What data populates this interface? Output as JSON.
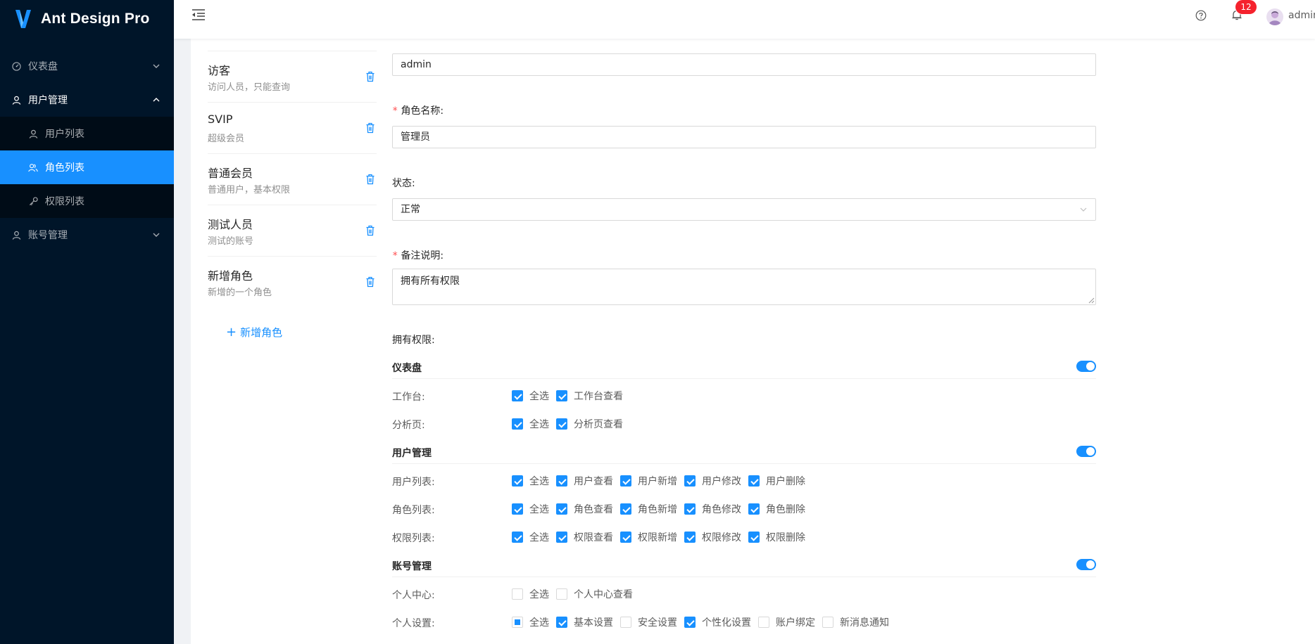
{
  "app": {
    "title": "Ant Design Pro"
  },
  "sidebar": {
    "items": [
      {
        "label": "仪表盘",
        "icon": "dashboard-icon",
        "open": false
      },
      {
        "label": "用户管理",
        "icon": "user-icon",
        "open": true,
        "children": [
          {
            "label": "用户列表",
            "icon": "user-icon"
          },
          {
            "label": "角色列表",
            "icon": "team-icon",
            "active": true
          },
          {
            "label": "权限列表",
            "icon": "key-icon"
          }
        ]
      },
      {
        "label": "账号管理",
        "icon": "user-icon",
        "open": false
      }
    ]
  },
  "header": {
    "notification_count": "12",
    "user_name": "admin"
  },
  "roles": {
    "items": [
      {
        "name": "访客",
        "desc": "访问人员，只能查询"
      },
      {
        "name": "SVIP",
        "desc": "超级会员"
      },
      {
        "name": "普通会员",
        "desc": "普通用户，基本权限"
      },
      {
        "name": "测试人员",
        "desc": "测试的账号"
      },
      {
        "name": "新增角色",
        "desc": "新增的一个角色"
      }
    ],
    "add_label": "新增角色"
  },
  "form": {
    "role_key_value": "admin",
    "role_name_label": "角色名称:",
    "role_name_value": "管理员",
    "status_label": "状态:",
    "status_value": "正常",
    "remark_label": "备注说明:",
    "remark_value": "拥有所有权限",
    "permissions_label": "拥有权限:"
  },
  "permissions": {
    "groups": [
      {
        "title": "仪表盘",
        "enabled": true,
        "rows": [
          {
            "label": "工作台:",
            "options": [
              {
                "label": "全选",
                "state": "checked"
              },
              {
                "label": "工作台查看",
                "state": "checked"
              }
            ]
          },
          {
            "label": "分析页:",
            "options": [
              {
                "label": "全选",
                "state": "checked"
              },
              {
                "label": "分析页查看",
                "state": "checked"
              }
            ]
          }
        ]
      },
      {
        "title": "用户管理",
        "enabled": true,
        "rows": [
          {
            "label": "用户列表:",
            "options": [
              {
                "label": "全选",
                "state": "checked"
              },
              {
                "label": "用户查看",
                "state": "checked"
              },
              {
                "label": "用户新增",
                "state": "checked"
              },
              {
                "label": "用户修改",
                "state": "checked"
              },
              {
                "label": "用户删除",
                "state": "checked"
              }
            ]
          },
          {
            "label": "角色列表:",
            "options": [
              {
                "label": "全选",
                "state": "checked"
              },
              {
                "label": "角色查看",
                "state": "checked"
              },
              {
                "label": "角色新增",
                "state": "checked"
              },
              {
                "label": "角色修改",
                "state": "checked"
              },
              {
                "label": "角色删除",
                "state": "checked"
              }
            ]
          },
          {
            "label": "权限列表:",
            "options": [
              {
                "label": "全选",
                "state": "checked"
              },
              {
                "label": "权限查看",
                "state": "checked"
              },
              {
                "label": "权限新增",
                "state": "checked"
              },
              {
                "label": "权限修改",
                "state": "checked"
              },
              {
                "label": "权限删除",
                "state": "checked"
              }
            ]
          }
        ]
      },
      {
        "title": "账号管理",
        "enabled": true,
        "rows": [
          {
            "label": "个人中心:",
            "options": [
              {
                "label": "全选",
                "state": "unchecked"
              },
              {
                "label": "个人中心查看",
                "state": "unchecked"
              }
            ]
          },
          {
            "label": "个人设置:",
            "options": [
              {
                "label": "全选",
                "state": "indeterminate"
              },
              {
                "label": "基本设置",
                "state": "checked"
              },
              {
                "label": "安全设置",
                "state": "unchecked"
              },
              {
                "label": "个性化设置",
                "state": "checked"
              },
              {
                "label": "账户绑定",
                "state": "unchecked"
              },
              {
                "label": "新消息通知",
                "state": "unchecked"
              }
            ]
          }
        ]
      }
    ]
  },
  "colors": {
    "primary": "#1890ff",
    "sider": "#001529",
    "danger": "#ff4d4f"
  }
}
